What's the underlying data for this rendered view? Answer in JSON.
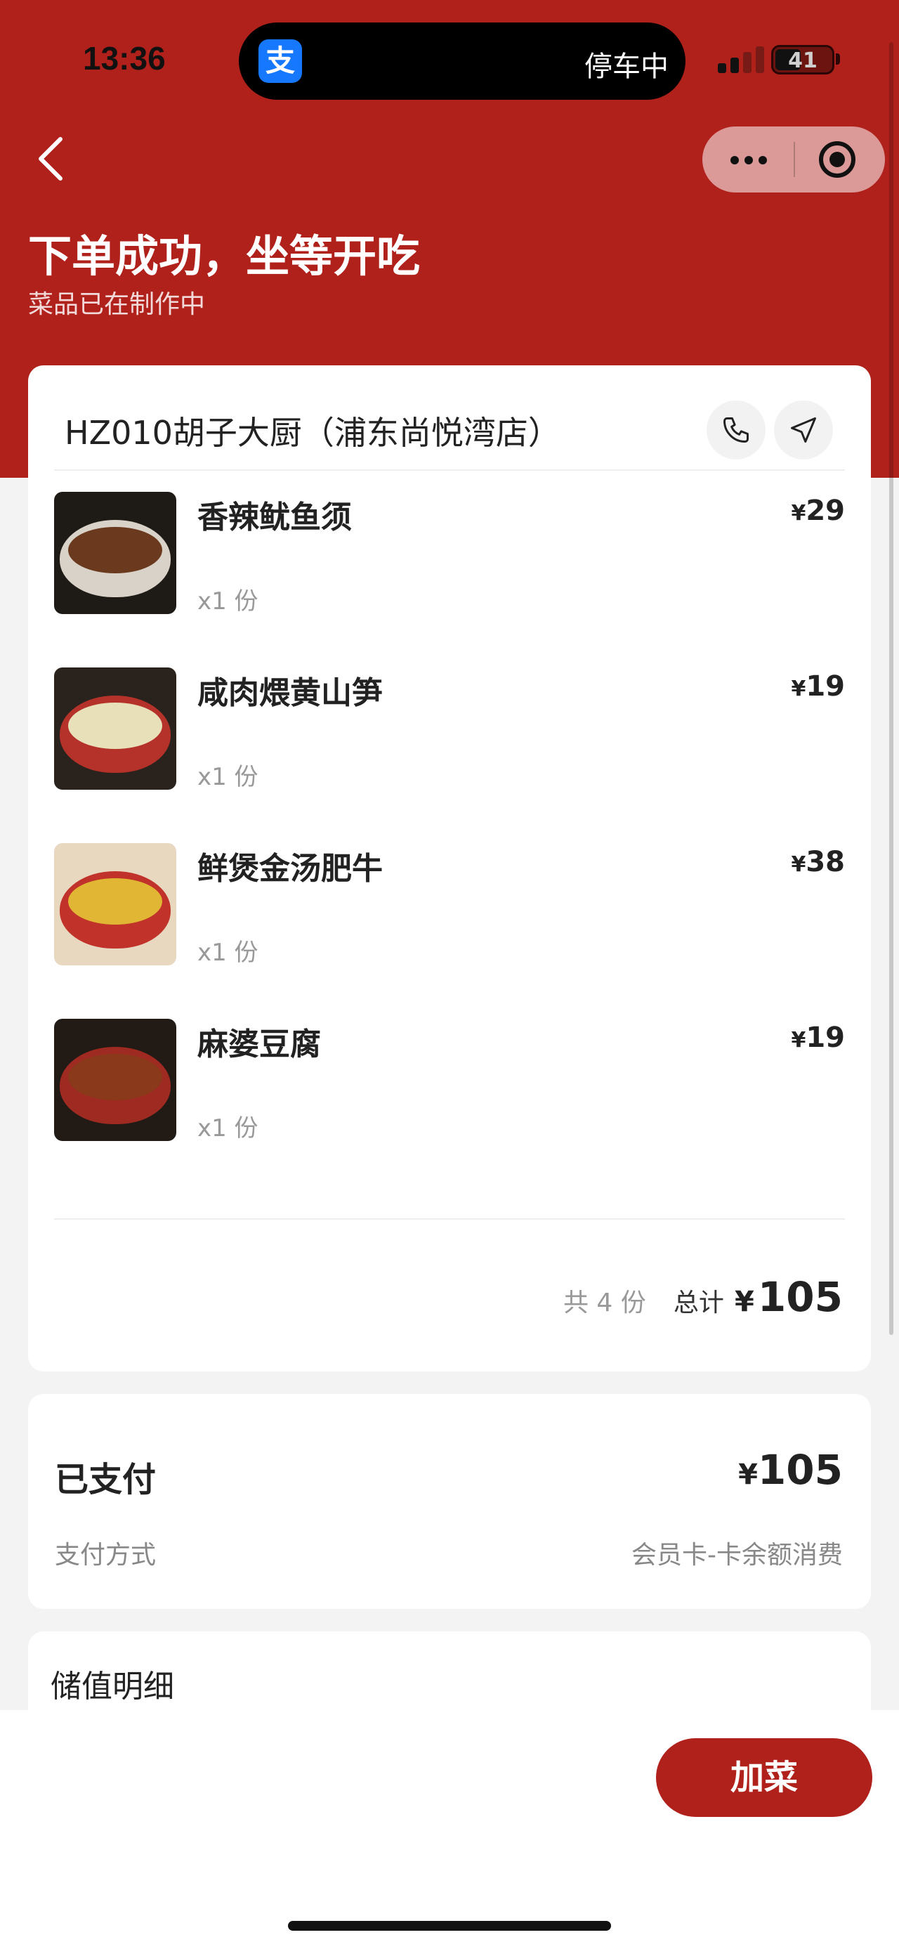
{
  "status_bar": {
    "time": "13:36",
    "island_app_icon": "支",
    "island_text": "停车中",
    "battery": "41"
  },
  "header": {
    "title": "下单成功，坐等开吃",
    "subtitle": "菜品已在制作中",
    "bg_color": "#b0211b"
  },
  "order": {
    "store_name": "HZ010胡子大厨（浦东尚悦湾店）",
    "items": [
      {
        "name": "香辣鱿鱼须",
        "qty": "x1 份",
        "currency": "¥",
        "price": "29"
      },
      {
        "name": "咸肉煨黄山笋",
        "qty": "x1 份",
        "currency": "¥",
        "price": "19"
      },
      {
        "name": "鲜煲金汤肥牛",
        "qty": "x1 份",
        "currency": "¥",
        "price": "38"
      },
      {
        "name": "麻婆豆腐",
        "qty": "x1 份",
        "currency": "¥",
        "price": "19"
      }
    ],
    "count_text": "共 4 份",
    "total_label": "总计",
    "total_currency": "¥",
    "total_amount": "105"
  },
  "payment": {
    "label": "已支付",
    "currency": "¥",
    "amount": "105",
    "method_label": "支付方式",
    "method_value": "会员卡-卡余额消费"
  },
  "stored_value": {
    "label": "储值明细"
  },
  "bottom": {
    "add_button": "加菜"
  }
}
